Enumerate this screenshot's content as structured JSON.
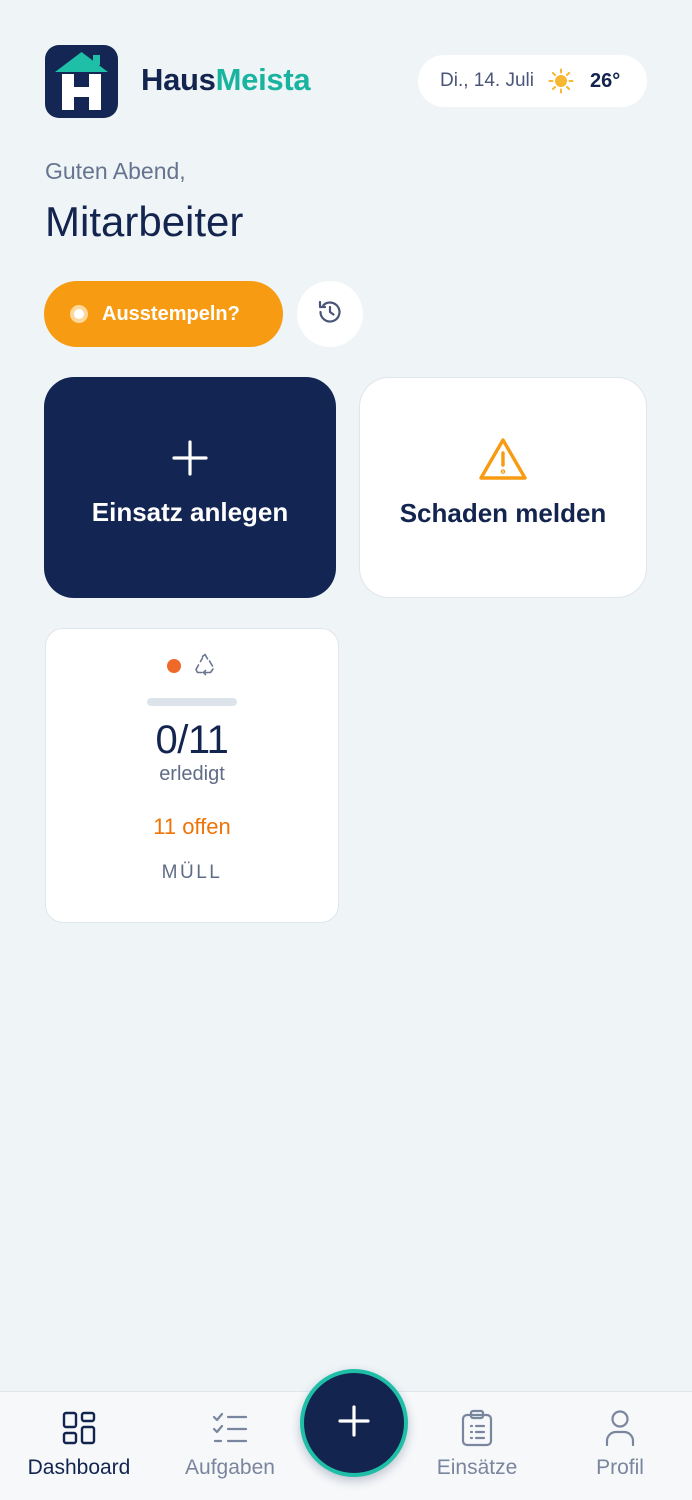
{
  "app": {
    "brand_part1": "Haus",
    "brand_part2": "Meista",
    "logo_letter": "H"
  },
  "weather": {
    "date": "Di., 14. Juli",
    "icon": "sun-icon",
    "temperature": "26°"
  },
  "greeting": {
    "salutation": "Guten Abend,",
    "name": "Mitarbeiter"
  },
  "clock": {
    "button_label": "Ausstempeln?",
    "history_icon": "history-icon"
  },
  "actions": [
    {
      "label": "Einsatz anlegen",
      "icon": "plus-icon"
    },
    {
      "label": "Schaden melden",
      "icon": "warning-icon"
    }
  ],
  "task_card": {
    "status_icon": "recycle-icon",
    "progress": 0,
    "count": "0/11",
    "done_label": "erledigt",
    "open_label": "11 offen",
    "category": "MÜLL"
  },
  "bottom_nav": {
    "items": [
      {
        "label": "Dashboard",
        "icon": "dashboard-icon",
        "active": true
      },
      {
        "label": "Aufgaben",
        "icon": "tasks-icon",
        "active": false
      },
      {
        "label": "Einsätze",
        "icon": "clipboard-icon",
        "active": false
      },
      {
        "label": "Profil",
        "icon": "user-icon",
        "active": false
      }
    ],
    "fab_icon": "plus-icon"
  },
  "colors": {
    "navy": "#13244f",
    "teal": "#18b4a0",
    "orange": "#f79b13",
    "background": "#eff4f7"
  }
}
